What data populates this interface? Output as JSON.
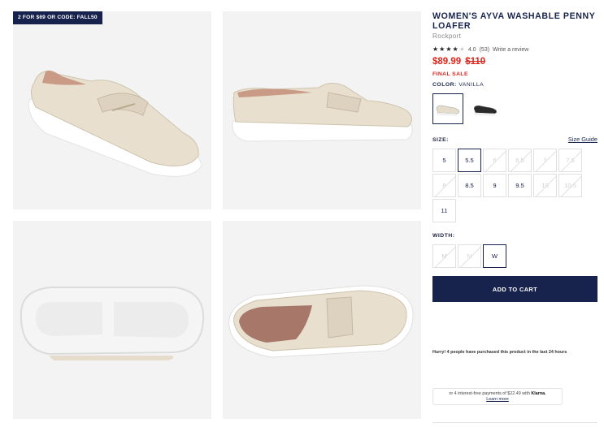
{
  "promo": "2 FOR $69 OR CODE: FALL50",
  "product": {
    "title": "WOMEN'S AYVA WASHABLE PENNY LOAFER",
    "brand": "Rockport",
    "rating": 4.0,
    "rating_text": "4.0",
    "reviews_text": "(53)",
    "write_review": "Write a review",
    "price": "$89.99",
    "original_price": "$110",
    "final_sale": "FINAL SALE",
    "color_label": "COLOR:",
    "color_value": "VANILLA"
  },
  "swatches": [
    {
      "name": "Vanilla",
      "color": "#e6dccb",
      "selected": true
    },
    {
      "name": "Black",
      "color": "#2a2a2a",
      "selected": false
    }
  ],
  "size": {
    "label": "SIZE:",
    "guide": "Size Guide",
    "options": [
      {
        "v": "5",
        "available": true,
        "selected": false
      },
      {
        "v": "5.5",
        "available": true,
        "selected": true
      },
      {
        "v": "6",
        "available": false,
        "selected": false
      },
      {
        "v": "6.5",
        "available": false,
        "selected": false
      },
      {
        "v": "7",
        "available": false,
        "selected": false
      },
      {
        "v": "7.5",
        "available": false,
        "selected": false
      },
      {
        "v": "8",
        "available": false,
        "selected": false
      },
      {
        "v": "8.5",
        "available": true,
        "selected": false
      },
      {
        "v": "9",
        "available": true,
        "selected": false
      },
      {
        "v": "9.5",
        "available": true,
        "selected": false
      },
      {
        "v": "10",
        "available": false,
        "selected": false
      },
      {
        "v": "10.5",
        "available": false,
        "selected": false
      },
      {
        "v": "11",
        "available": true,
        "selected": false
      }
    ]
  },
  "width": {
    "label": "WIDTH:",
    "options": [
      {
        "v": "M",
        "available": false,
        "selected": false
      },
      {
        "v": "N",
        "available": false,
        "selected": false
      },
      {
        "v": "W",
        "available": true,
        "selected": true
      }
    ]
  },
  "cta": {
    "add_to_cart": "ADD TO CART"
  },
  "hurry": "Hurry! 4 people have purchased this product in the last 24 hours",
  "klarna": {
    "text": "or 4 interest-free payments of $22.49 with",
    "brand": "Klarna.",
    "learn_more": "Learn more"
  },
  "colors": {
    "navy": "#17234d",
    "sale_red": "#e2231a",
    "shoe_cream": "#e6dccb",
    "sole_white": "#f7f7f7"
  }
}
